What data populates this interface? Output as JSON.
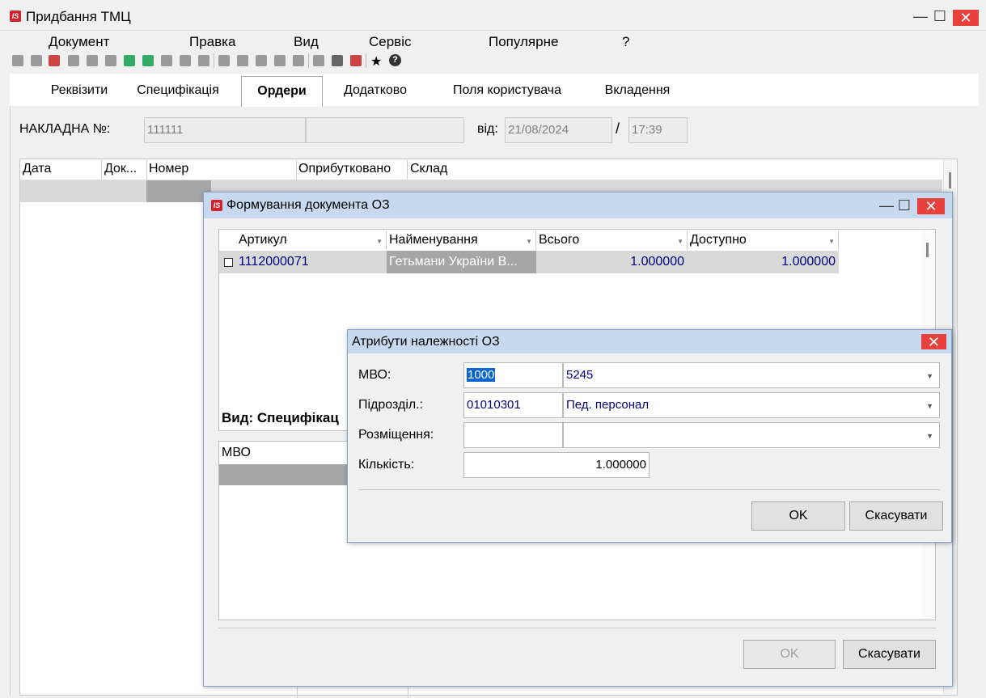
{
  "window": {
    "title": "Придбання ТМЦ",
    "logo": "IS"
  },
  "menu": [
    "Документ",
    "Правка",
    "Вид",
    "Сервіс",
    "Популярне",
    "?"
  ],
  "tabs": [
    {
      "label": "Реквізити"
    },
    {
      "label": "Специфікація"
    },
    {
      "label": "Ордери"
    },
    {
      "label": "Додатково"
    },
    {
      "label": "Поля користувача"
    },
    {
      "label": "Вкладення"
    }
  ],
  "invoice": {
    "label": "НАКЛАДНА №:",
    "number": "111111",
    "extra": "",
    "date_label": "від:",
    "date": "21/08/2024",
    "sep": "/",
    "time": "17:39"
  },
  "orders_grid": {
    "columns": [
      "Дата",
      "Док...",
      "Номер",
      "Оприбутковано",
      "Склад"
    ]
  },
  "os_dialog": {
    "title": "Формування документа ОЗ",
    "columns": [
      "Артикул",
      "Найменування",
      "Всього",
      "Доступно"
    ],
    "rows": [
      {
        "article": "1112000071",
        "name": "Гетьмани України В...",
        "total": "1.000000",
        "available": "1.000000"
      }
    ],
    "view_label": "Вид: Специфікац",
    "mvo_header": "МВО",
    "ok": "OK",
    "cancel": "Скасувати"
  },
  "attr_dialog": {
    "title": "Атрибути належності ОЗ",
    "mvo_label": "МВО:",
    "mvo_code": "1000",
    "mvo_value": "5245",
    "dept_label": "Підрозділ.:",
    "dept_code": "01010301",
    "dept_value": "Пед. персонал",
    "place_label": "Розміщення:",
    "place_code": "",
    "place_value": "",
    "qty_label": "Кількість:",
    "qty_value": "1.000000",
    "ok": "OK",
    "cancel": "Скасувати"
  }
}
